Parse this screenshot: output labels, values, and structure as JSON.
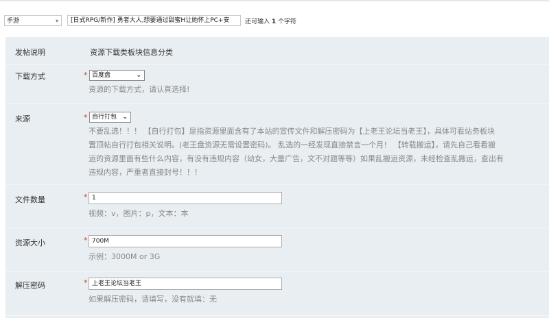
{
  "header": {
    "category": "手游",
    "title_value": "[日式RPG/新作] 勇者大人,想要通过甜蜜H让她怀上PC+安",
    "remain_prefix": "还可输入",
    "remain_count": "1",
    "remain_suffix": "个字符"
  },
  "form": {
    "intro": {
      "label": "发帖说明",
      "value": "资源下载类板块信息分类"
    },
    "download": {
      "label": "下载方式",
      "required": "*",
      "selected": "百度盘",
      "hint": "资源的下载方式，请认真选择!"
    },
    "source": {
      "label": "来源",
      "required": "*",
      "selected": "自行打包",
      "hint_lines": [
        "不要乱选！！！ 【自行打包】是指资源里面含有了本站的宣传文件和解压密码为【上老王论坛当老王】，具体可看站务板块",
        "置顶帖自行打包相关说明。(老王盘资源无需设置密码)。 乱选的一经发现直接禁言一个月！ 【转载搬运】，请先自己看看搬",
        "运的资源里面有些什么内容，有没有违规内容（幼女，大量广告，文不对题等等）如果乱搬运资源，未经检查乱搬运，查出有",
        "违规内容，严重者直接封号！！！"
      ]
    },
    "file_count": {
      "label": "文件数量",
      "required": "*",
      "value": "1",
      "hint": "视频：v，图片：p，文本：本"
    },
    "size": {
      "label": "资源大小",
      "required": "*",
      "value": "700M",
      "hint": "示例：3000M or 3G"
    },
    "password": {
      "label": "解压密码",
      "required": "*",
      "value": "上老王论坛当老王",
      "hint": "如果解压密码，请填写，没有就填：无"
    }
  }
}
